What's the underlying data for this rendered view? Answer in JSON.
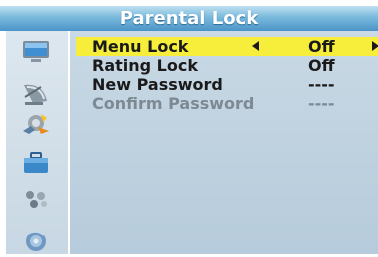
{
  "title": "Parental Lock",
  "sidebar": {
    "items": [
      {
        "icon": "monitor-icon"
      },
      {
        "icon": "satellite-dish-icon"
      },
      {
        "icon": "settings-icon"
      },
      {
        "icon": "toolbox-icon"
      },
      {
        "icon": "dots-icon"
      },
      {
        "icon": "disc-icon"
      }
    ]
  },
  "menu": {
    "items": [
      {
        "label": "Menu Lock",
        "value": "Off",
        "selected": true
      },
      {
        "label": "Rating Lock",
        "value": "Off"
      },
      {
        "label": "New Password",
        "value": "----"
      },
      {
        "label": "Confirm Password",
        "value": "----",
        "disabled": true
      }
    ]
  },
  "colors": {
    "title_bar": "#4b94c8",
    "highlight": "#f6ee3a",
    "panel": "#c9d9e5"
  }
}
